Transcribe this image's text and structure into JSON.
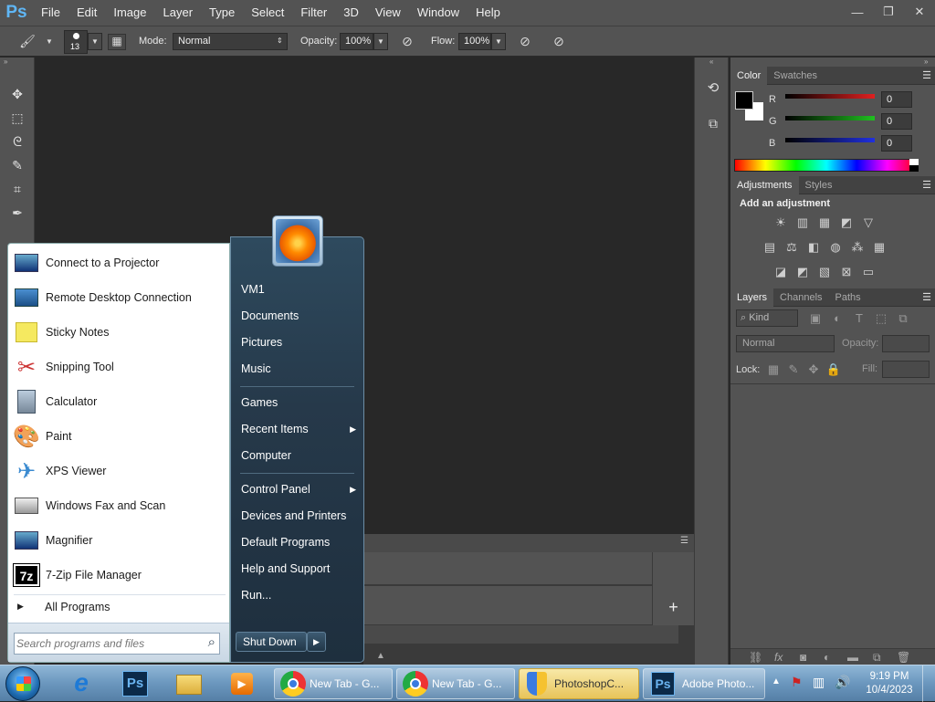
{
  "menubar": {
    "logo": "Ps",
    "items": [
      "File",
      "Edit",
      "Image",
      "Layer",
      "Type",
      "Select",
      "Filter",
      "3D",
      "View",
      "Window",
      "Help"
    ],
    "minimize": "—",
    "restore": "❐",
    "close": "✕"
  },
  "options": {
    "brush_size": "13",
    "mode_label": "Mode:",
    "mode_value": "Normal",
    "opacity_label": "Opacity:",
    "opacity_value": "100%",
    "flow_label": "Flow:",
    "flow_value": "100%"
  },
  "color_panel": {
    "tabs": [
      "Color",
      "Swatches"
    ],
    "channels": [
      {
        "name": "R",
        "value": "0",
        "color": "#e02020"
      },
      {
        "name": "G",
        "value": "0",
        "color": "#20c020"
      },
      {
        "name": "B",
        "value": "0",
        "color": "#2030e0"
      }
    ]
  },
  "adjustments_panel": {
    "tabs": [
      "Adjustments",
      "Styles"
    ],
    "heading": "Add an adjustment"
  },
  "layers_panel": {
    "tabs": [
      "Layers",
      "Channels",
      "Paths"
    ],
    "kind_label": "Kind",
    "blend_value": "Normal",
    "opacity_label": "Opacity:",
    "lock_label": "Lock:",
    "fill_label": "Fill:"
  },
  "start_menu": {
    "programs": [
      {
        "label": "Connect to a Projector",
        "icon": "projector-icon"
      },
      {
        "label": "Remote Desktop Connection",
        "icon": "remote-desktop-icon"
      },
      {
        "label": "Sticky Notes",
        "icon": "sticky-notes-icon"
      },
      {
        "label": "Snipping Tool",
        "icon": "scissors-icon"
      },
      {
        "label": "Calculator",
        "icon": "calculator-icon"
      },
      {
        "label": "Paint",
        "icon": "palette-icon"
      },
      {
        "label": "XPS Viewer",
        "icon": "xps-icon"
      },
      {
        "label": "Windows Fax and Scan",
        "icon": "fax-icon"
      },
      {
        "label": "Magnifier",
        "icon": "magnifier-icon"
      },
      {
        "label": "7-Zip File Manager",
        "icon": "7zip-icon"
      }
    ],
    "all_programs": "All Programs",
    "search_placeholder": "Search programs and files",
    "places": [
      "VM1",
      "Documents",
      "Pictures",
      "Music",
      "Games",
      "Recent Items",
      "Computer",
      "Control Panel",
      "Devices and Printers",
      "Default Programs",
      "Help and Support",
      "Run..."
    ],
    "shutdown": "Shut Down"
  },
  "taskbar": {
    "tasks": [
      {
        "label": "New Tab - G...",
        "icon": "chrome-icon"
      },
      {
        "label": "New Tab - G...",
        "icon": "chrome-icon"
      },
      {
        "label": "PhotoshopC...",
        "icon": "shield-icon"
      },
      {
        "label": "Adobe Photo...",
        "icon": "photoshop-icon"
      }
    ],
    "time": "9:19 PM",
    "date": "10/4/2023"
  }
}
